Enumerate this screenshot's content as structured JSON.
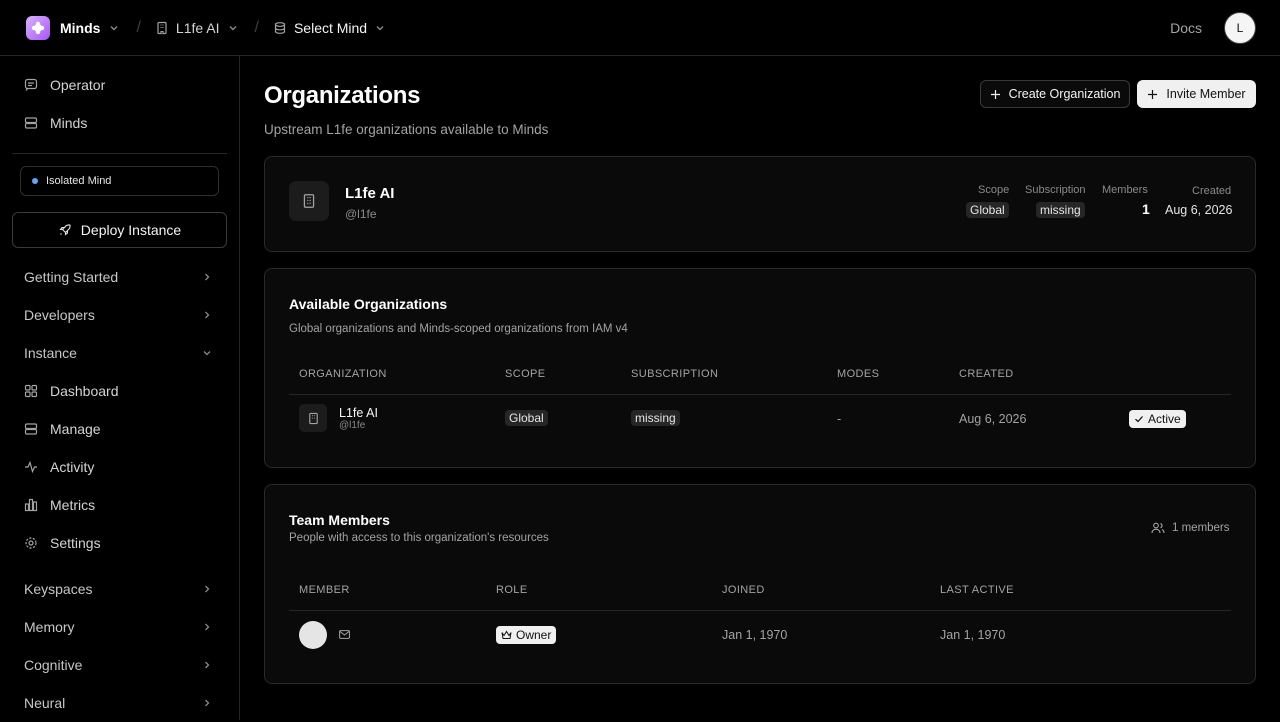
{
  "topbar": {
    "brand": "Minds",
    "org": "L1fe AI",
    "mind": "Select Mind",
    "docs": "Docs",
    "avatar_initial": "L"
  },
  "sidebar": {
    "top_items": [
      {
        "label": "Operator",
        "icon": "message-square-icon"
      },
      {
        "label": "Minds",
        "icon": "server-icon"
      }
    ],
    "isolated_label": "Isolated Mind",
    "deploy_label": "Deploy Instance",
    "groups_before": [
      {
        "label": "Getting Started"
      },
      {
        "label": "Developers"
      }
    ],
    "instance_label": "Instance",
    "instance_items": [
      {
        "label": "Dashboard",
        "icon": "layout-grid-icon"
      },
      {
        "label": "Manage",
        "icon": "server-icon"
      },
      {
        "label": "Activity",
        "icon": "activity-icon"
      },
      {
        "label": "Metrics",
        "icon": "bar-chart-icon"
      },
      {
        "label": "Settings",
        "icon": "gear-icon"
      }
    ],
    "groups_after": [
      {
        "label": "Keyspaces"
      },
      {
        "label": "Memory"
      },
      {
        "label": "Cognitive"
      },
      {
        "label": "Neural"
      }
    ]
  },
  "page": {
    "title": "Organizations",
    "subtitle": "Upstream L1fe organizations available to Minds",
    "create_btn": "Create Organization",
    "invite_btn": "Invite Member"
  },
  "current_org": {
    "name": "L1fe AI",
    "handle": "@l1fe",
    "scope_label": "Scope",
    "scope": "Global",
    "subscription_label": "Subscription",
    "subscription": "missing",
    "members_label": "Members",
    "members": "1",
    "created_label": "Created",
    "created": "Aug 6, 2026"
  },
  "available": {
    "title": "Available Organizations",
    "subtitle": "Global organizations and Minds-scoped organizations from IAM v4",
    "headers": [
      "ORGANIZATION",
      "SCOPE",
      "SUBSCRIPTION",
      "MODES",
      "CREATED"
    ],
    "rows": [
      {
        "name": "L1fe AI",
        "handle": "@l1fe",
        "scope": "Global",
        "subscription": "missing",
        "modes": "-",
        "created": "Aug 6, 2026",
        "status": "Active"
      }
    ]
  },
  "team": {
    "title": "Team Members",
    "subtitle": "People with access to this organization's resources",
    "count_label": "1 members",
    "headers": [
      "MEMBER",
      "ROLE",
      "JOINED",
      "LAST ACTIVE"
    ],
    "rows": [
      {
        "role": "Owner",
        "joined": "Jan 1, 1970",
        "last_active": "Jan 1, 1970"
      }
    ]
  }
}
